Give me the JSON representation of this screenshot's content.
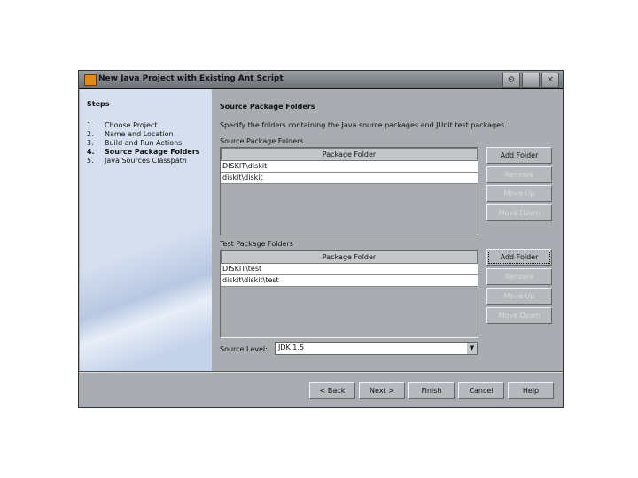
{
  "window": {
    "title": "New Java Project with Existing Ant Script"
  },
  "steps": {
    "heading": "Steps",
    "items": [
      {
        "num": "1.",
        "label": "Choose Project"
      },
      {
        "num": "2.",
        "label": "Name and Location"
      },
      {
        "num": "3.",
        "label": "Build and Run Actions"
      },
      {
        "num": "4.",
        "label": "Source Package Folders",
        "current": true
      },
      {
        "num": "5.",
        "label": "Java Sources Classpath"
      }
    ]
  },
  "main": {
    "title": "Source Package Folders",
    "description": "Specify the folders containing the Java source packages and JUnit test packages.",
    "source": {
      "label": "Source Package Folders",
      "column": "Package Folder",
      "rows": [
        "DISKIT\\diskit",
        "diskit\\diskit"
      ]
    },
    "test": {
      "label": "Test Package Folders",
      "column": "Package Folder",
      "rows": [
        "DISKIT\\test",
        "diskit\\diskit\\test"
      ]
    },
    "buttons": {
      "add": "Add Folder",
      "remove": "Remove",
      "up": "Move Up",
      "down": "Move Down"
    },
    "source_level": {
      "label": "Source Level:",
      "value": "JDK 1.5"
    }
  },
  "footer": {
    "back": "< Back",
    "next": "Next >",
    "finish": "Finish",
    "cancel": "Cancel",
    "help": "Help"
  }
}
